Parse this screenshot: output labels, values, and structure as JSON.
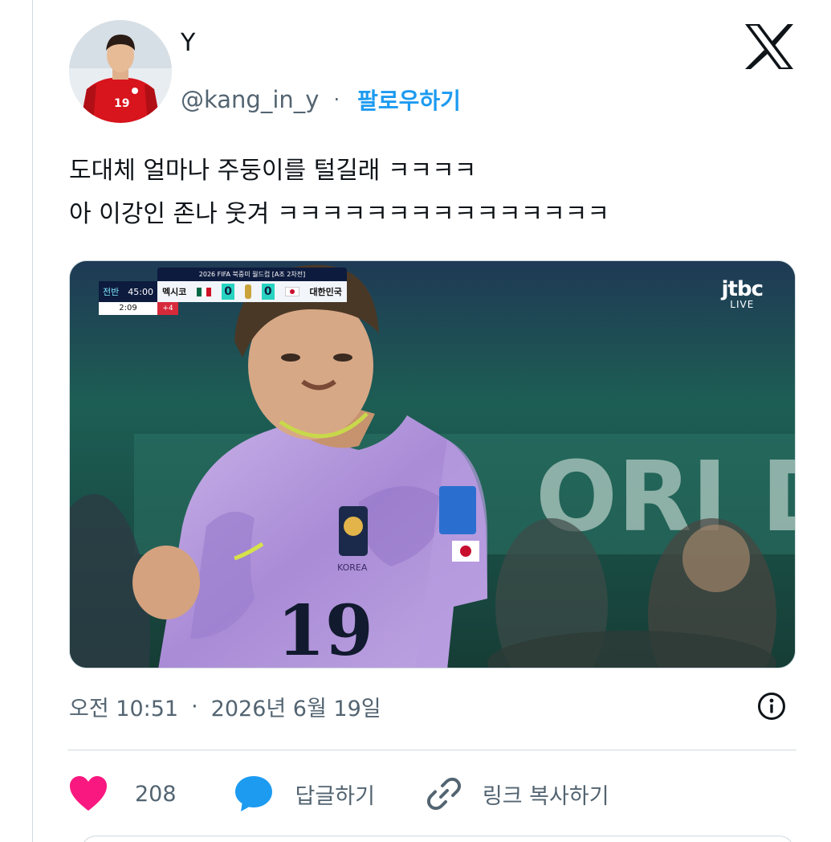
{
  "author": {
    "display_name": "Y",
    "handle": "@kang_in_y",
    "separator": "·",
    "follow_label": "팔로우하기"
  },
  "tweet": {
    "lines": [
      "도대체 얼마나 주둥이를 털길래 ㅋㅋㅋㅋ",
      "아 이강인 존나 웃겨 ㅋㅋㅋㅋㅋㅋㅋㅋㅋㅋㅋㅋㅋㅋㅋ"
    ]
  },
  "media": {
    "scorebug": {
      "competition": "2026 FIFA 북중미 월드컵 [A조 2차전]",
      "half": "전반",
      "half_time": "45:00",
      "home_team": "멕시코",
      "home_score": "0",
      "away_score": "0",
      "away_team": "대한민국",
      "clock": "2:09",
      "added_time": "+4"
    },
    "broadcaster": "jtbc",
    "live_label": "LIVE",
    "jersey_number": "19",
    "jersey_text": "KOREA"
  },
  "meta": {
    "time": "오전 10:51",
    "separator": "·",
    "date": "2026년 6월 19일"
  },
  "actions": {
    "like_count": "208",
    "reply_label": "답글하기",
    "copy_link_label": "링크 복사하기"
  },
  "colors": {
    "accent": "#1d9bf0",
    "like": "#f91880",
    "muted": "#536471",
    "border": "#cfd9de"
  },
  "icons": {
    "logo": "x-logo-icon",
    "info": "info-icon",
    "like": "heart-icon",
    "reply": "speech-bubble-icon",
    "copy": "link-icon"
  }
}
